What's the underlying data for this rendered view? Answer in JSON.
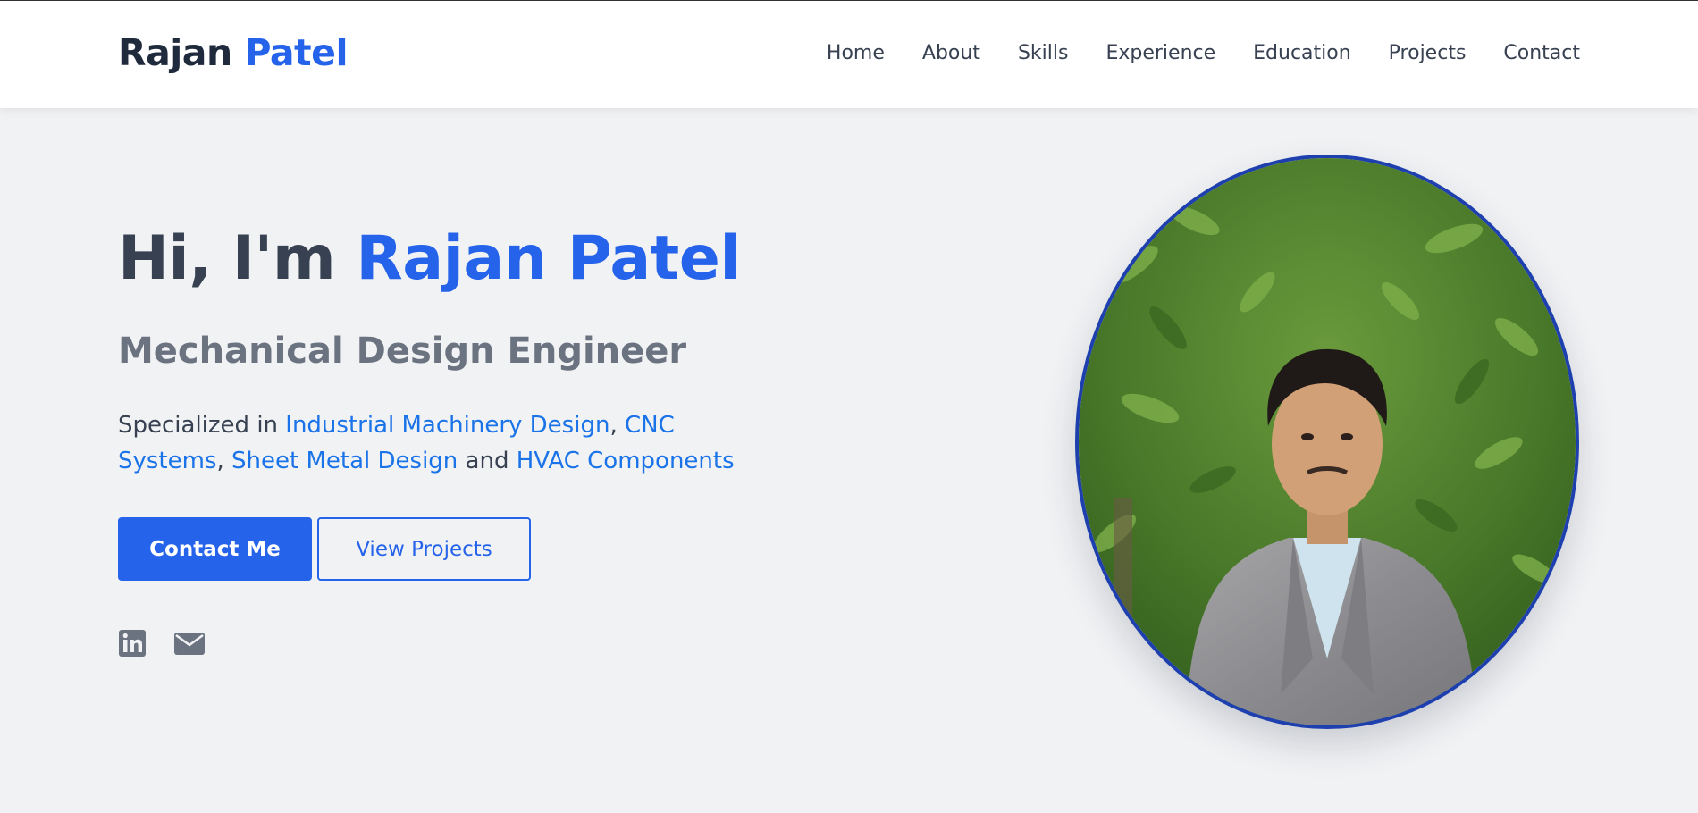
{
  "header": {
    "logo_first": "Rajan",
    "logo_last": "Patel",
    "nav": [
      "Home",
      "About",
      "Skills",
      "Experience",
      "Education",
      "Projects",
      "Contact"
    ]
  },
  "hero": {
    "greeting": "Hi, I'm ",
    "name": "Rajan Patel",
    "role": "Mechanical Design Engineer",
    "spec_prefix": "Specialized in ",
    "spec_items": [
      "Industrial Machinery Design",
      "CNC Systems",
      "Sheet Metal Design",
      "HVAC Components"
    ],
    "spec_sep": ", ",
    "spec_and": " and ",
    "contact_button": "Contact Me",
    "projects_button": "View Projects"
  },
  "social": [
    "linkedin-icon",
    "email-icon"
  ],
  "colors": {
    "accent": "#2563eb",
    "highlight": "#1a73e8",
    "background": "#f1f2f4",
    "text": "#374151"
  }
}
